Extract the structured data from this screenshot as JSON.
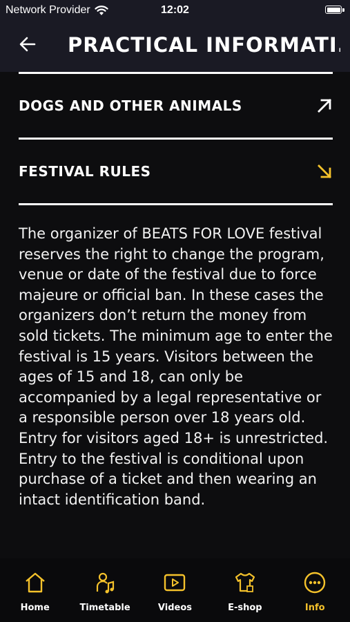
{
  "status_bar": {
    "carrier": "Network Provider",
    "time": "12:02"
  },
  "header": {
    "title": "PRACTICAL INFORMATI..."
  },
  "sections": [
    {
      "label": "DOGS AND OTHER ANIMALS",
      "arrow": "arrow-up-right-icon"
    },
    {
      "label": "FESTIVAL RULES",
      "arrow": "arrow-down-right-icon"
    }
  ],
  "body_text": "The organizer of BEATS FOR LOVE festival reserves the right to change the program, venue or date of the festival due to force majeure or official ban. In these cases the organizers don’t return the money from sold tickets. The minimum age to enter the festival is 15 years. Visitors between the ages of 15 and 18, can only be accompanied by a legal representative or a responsible person over 18 years old. Entry for visitors aged 18+ is unrestricted. Entry to the festival is conditional upon purchase of a ticket and then wearing an intact identification band.",
  "tabs": [
    {
      "label": "Home",
      "icon": "home-icon"
    },
    {
      "label": "Timetable",
      "icon": "timetable-icon"
    },
    {
      "label": "Videos",
      "icon": "play-icon"
    },
    {
      "label": "E-shop",
      "icon": "tshirt-icon"
    },
    {
      "label": "Info",
      "icon": "more-icon",
      "active": true
    }
  ],
  "colors": {
    "accent": "#f5c22b",
    "background": "#0d0d0f",
    "header": "#1a1a24"
  }
}
